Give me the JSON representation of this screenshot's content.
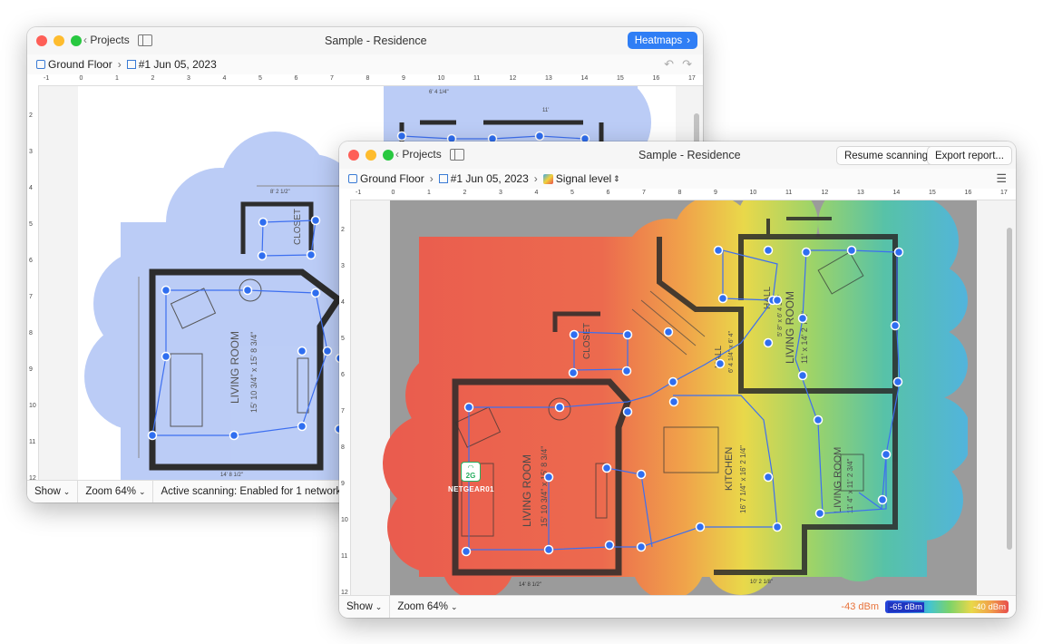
{
  "colors": {
    "accent": "#2f7ef5",
    "heat_high": "#e84d4d",
    "heat_low": "#3fa9e8",
    "coverage_blue": "#b5c8f5",
    "wall": "#2d2d2d",
    "survey_point": "#2f6ef0"
  },
  "back_window": {
    "title": "Sample - Residence",
    "back_label": "Projects",
    "heatmaps_button": "Heatmaps",
    "breadcrumb": {
      "floor": "Ground Floor",
      "survey": "#1 Jun 05, 2023"
    },
    "ruler_h": [
      "-1",
      "0",
      "1",
      "2",
      "3",
      "4",
      "5",
      "6",
      "7",
      "8",
      "9",
      "10",
      "11",
      "12",
      "13",
      "14",
      "15",
      "16",
      "17"
    ],
    "ruler_v": [
      "2",
      "3",
      "4",
      "5",
      "6",
      "7",
      "8",
      "9",
      "10",
      "11",
      "12"
    ],
    "plan_labels": {
      "room": "LIVING ROOM",
      "room_size": "15' 10 3/4\" x 15' 8 3/4\"",
      "closet": "CLOSET",
      "dim_top1": "8' 2 1/2\"",
      "dim_top2": "6' 4 1/4\"",
      "dim_top3": "11'",
      "dim_bottom": "14' 8 1/2\""
    },
    "bottom": {
      "show": "Show",
      "zoom": "Zoom 64%",
      "scanning": "Active scanning: Enabled for 1 networks"
    }
  },
  "front_window": {
    "title": "Sample - Residence",
    "back_label": "Projects",
    "resume_button": "Resume scanning",
    "export_button": "Export report...",
    "breadcrumb": {
      "floor": "Ground Floor",
      "survey": "#1 Jun 05, 2023",
      "visualization": "Signal level"
    },
    "ruler_h": [
      "-1",
      "0",
      "1",
      "2",
      "3",
      "4",
      "5",
      "6",
      "7",
      "8",
      "9",
      "10",
      "11",
      "12",
      "13",
      "14",
      "15",
      "16",
      "17"
    ],
    "ruler_v": [
      "2",
      "3",
      "4",
      "5",
      "6",
      "7",
      "8",
      "9",
      "10",
      "11",
      "12"
    ],
    "plan_labels": {
      "living_left": "LIVING ROOM",
      "living_left_size": "15' 10 3/4\" x 15' 8 3/4\"",
      "living_right": "LIVING ROOM",
      "living_right_size": "11' x 14' 2 7/8\"",
      "living_br": "LIVING ROOM",
      "living_br_size": "11' 4\" x 11' 2 3/4\"",
      "kitchen": "KITCHEN",
      "kitchen_size": "16' 7 1/4\" x 16' 2 1/4\"",
      "closet": "CLOSET",
      "hall1": "HALL",
      "hall1_size": "5' 8\" x 6' 4 3/8\"",
      "hall2": "HALL",
      "hall2_size": "6' 4 1/4\" x 6' 4\"",
      "dim_bottom_left": "14' 8 1/2\"",
      "dim_bottom_right": "10' 2 1/8\""
    },
    "access_point": {
      "band": "2G",
      "name": "NETGEAR01"
    },
    "bottom": {
      "show": "Show",
      "zoom": "Zoom 64%"
    },
    "legend": {
      "current": "-43 dBm",
      "min": "-65 dBm",
      "max": "-40 dBm"
    }
  }
}
